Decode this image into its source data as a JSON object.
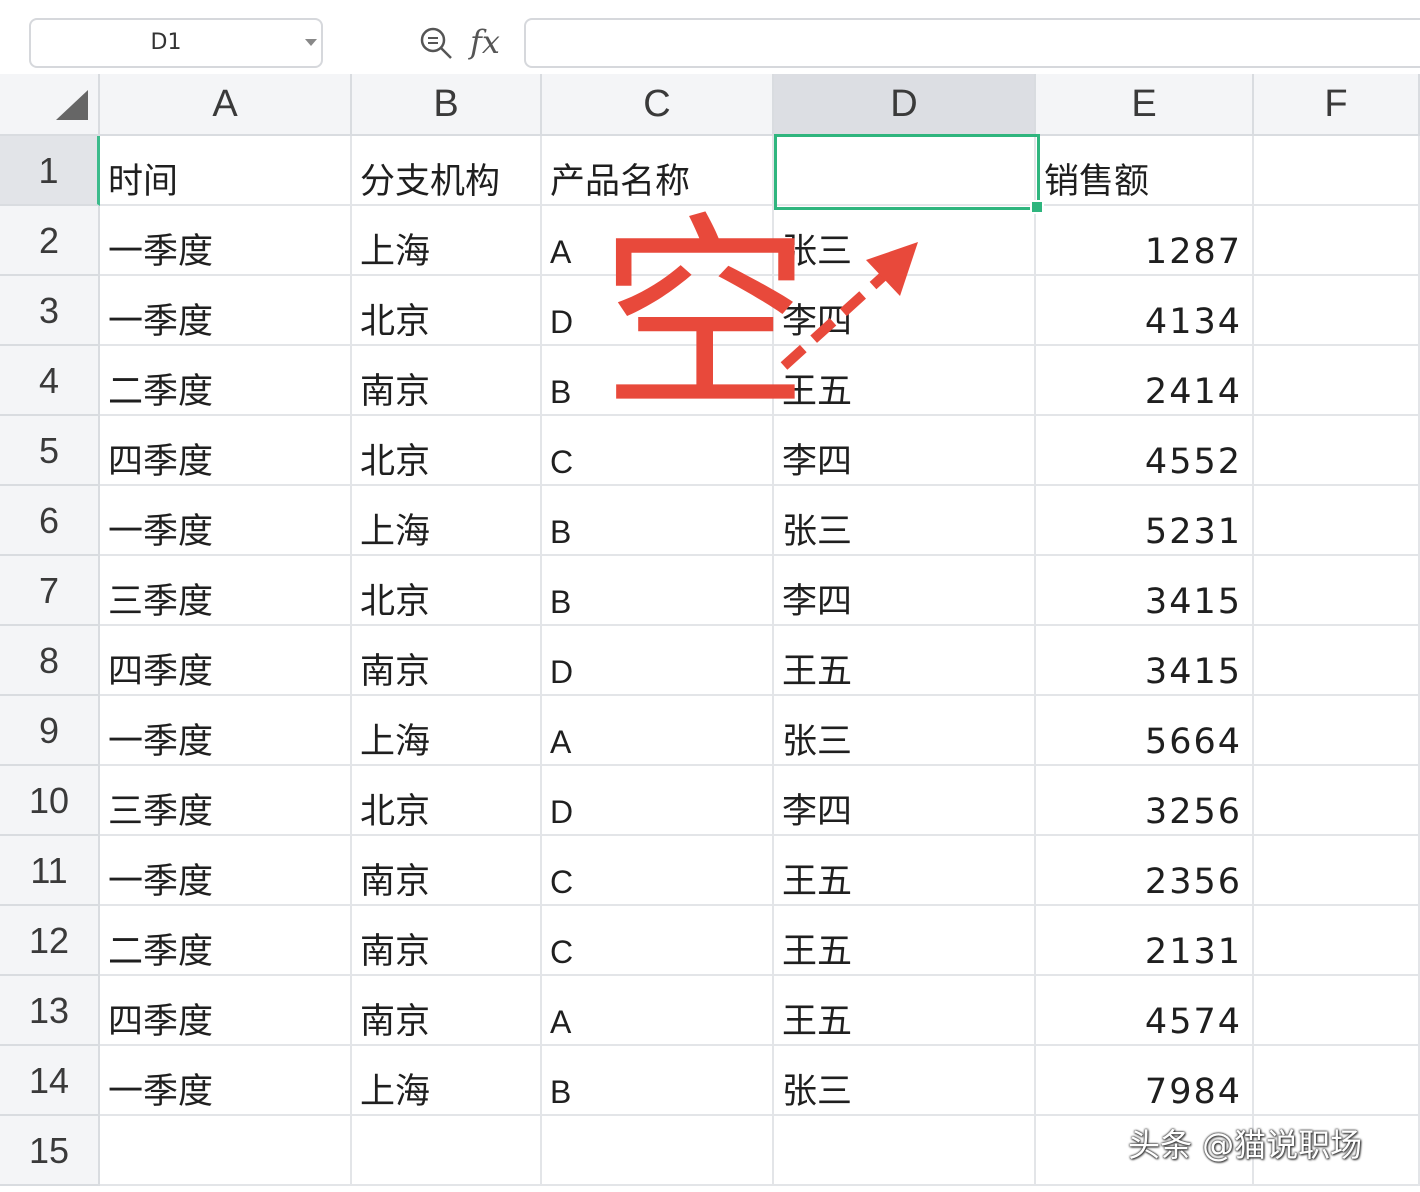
{
  "toolbar": {
    "name_box": "D1",
    "fx_label": "fx",
    "formula_value": "",
    "icons": [
      "zoom-formula-icon",
      "chevron-down-icon"
    ]
  },
  "columns": [
    "A",
    "B",
    "C",
    "D",
    "E",
    "F"
  ],
  "selected_column": "D",
  "selected_row": "1",
  "rows": [
    {
      "n": "1",
      "cells": [
        "时间",
        "分支机构",
        "产品名称",
        "",
        "销售额",
        ""
      ]
    },
    {
      "n": "2",
      "cells": [
        "一季度",
        "上海",
        "A",
        "张三",
        "1287",
        ""
      ]
    },
    {
      "n": "3",
      "cells": [
        "一季度",
        "北京",
        "D",
        "李四",
        "4134",
        ""
      ]
    },
    {
      "n": "4",
      "cells": [
        "二季度",
        "南京",
        "B",
        "王五",
        "2414",
        ""
      ]
    },
    {
      "n": "5",
      "cells": [
        "四季度",
        "北京",
        "C",
        "李四",
        "4552",
        ""
      ]
    },
    {
      "n": "6",
      "cells": [
        "一季度",
        "上海",
        "B",
        "张三",
        "5231",
        ""
      ]
    },
    {
      "n": "7",
      "cells": [
        "三季度",
        "北京",
        "B",
        "李四",
        "3415",
        ""
      ]
    },
    {
      "n": "8",
      "cells": [
        "四季度",
        "南京",
        "D",
        "王五",
        "3415",
        ""
      ]
    },
    {
      "n": "9",
      "cells": [
        "一季度",
        "上海",
        "A",
        "张三",
        "5664",
        ""
      ]
    },
    {
      "n": "10",
      "cells": [
        "三季度",
        "北京",
        "D",
        "李四",
        "3256",
        ""
      ]
    },
    {
      "n": "11",
      "cells": [
        "一季度",
        "南京",
        "C",
        "王五",
        "2356",
        ""
      ]
    },
    {
      "n": "12",
      "cells": [
        "二季度",
        "南京",
        "C",
        "王五",
        "2131",
        ""
      ]
    },
    {
      "n": "13",
      "cells": [
        "四季度",
        "南京",
        "A",
        "王五",
        "4574",
        ""
      ]
    },
    {
      "n": "14",
      "cells": [
        "一季度",
        "上海",
        "B",
        "张三",
        "7984",
        ""
      ]
    },
    {
      "n": "15",
      "cells": [
        "",
        "",
        "",
        "",
        "",
        ""
      ]
    }
  ],
  "annotation": {
    "text": "空",
    "color": "#e8493b"
  },
  "watermark": "头条 @猫说职场",
  "colors": {
    "selection": "#2fb57e",
    "header_bg": "#f4f5f7",
    "selected_header_bg": "#dcdee3"
  }
}
